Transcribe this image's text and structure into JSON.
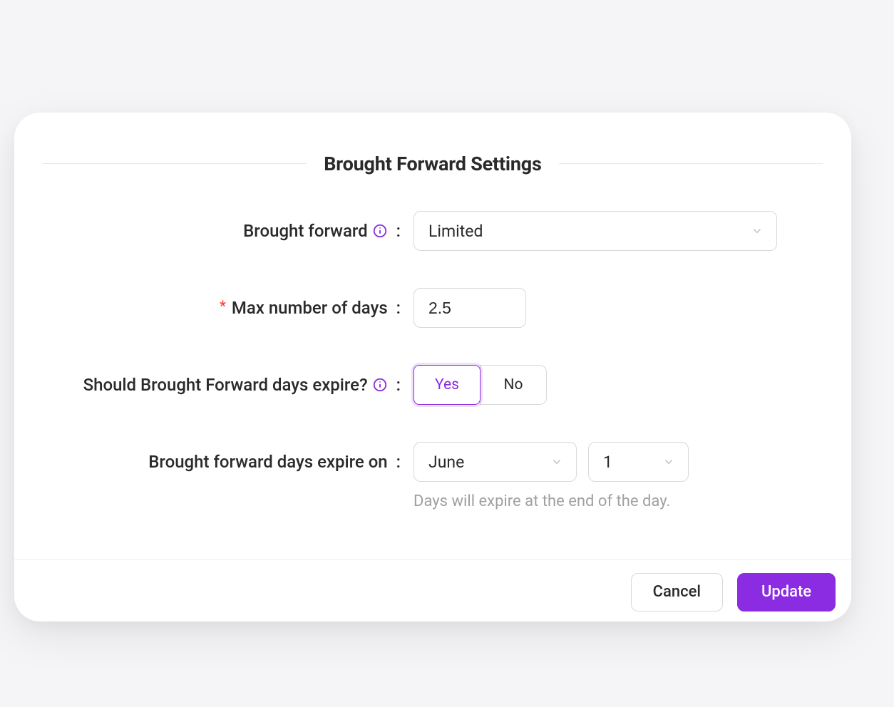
{
  "modal": {
    "title": "Brought Forward Settings",
    "fields": {
      "brought_forward": {
        "label": "Brought forward",
        "value": "Limited"
      },
      "max_days": {
        "required_mark": "*",
        "label": "Max number of days",
        "value": "2.5"
      },
      "expire_question": {
        "label": "Should Brought Forward days expire?",
        "yes": "Yes",
        "no": "No",
        "selected": "Yes"
      },
      "expire_on": {
        "label": "Brought forward days expire on",
        "month": "June",
        "day": "1",
        "helper": "Days will expire at the end of the day."
      }
    },
    "footer": {
      "cancel": "Cancel",
      "update": "Update"
    }
  }
}
